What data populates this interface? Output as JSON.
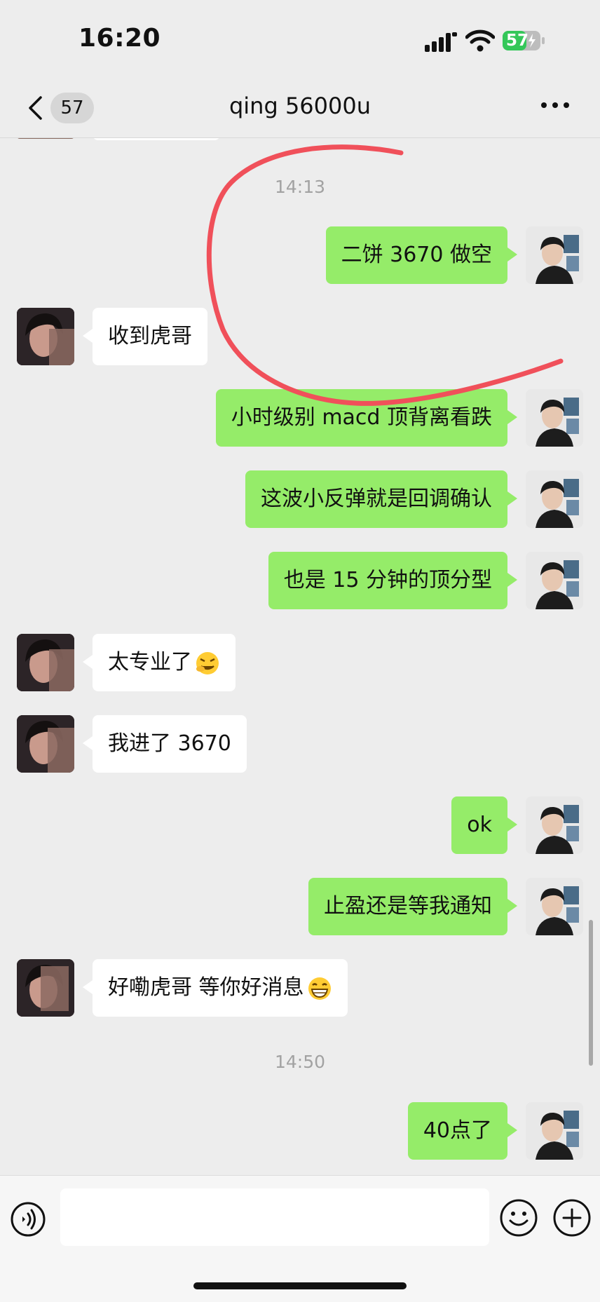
{
  "status_bar": {
    "time": "16:20",
    "battery": "57"
  },
  "header": {
    "unread_count": "57",
    "title": "qing 56000u"
  },
  "messages": {
    "ts1": "14:13",
    "m1": "二饼 3670 做空",
    "m2": "收到虎哥",
    "m3": "小时级别 macd 顶背离看跌",
    "m4": "这波小反弹就是回调确认",
    "m5": "也是 15 分钟的顶分型",
    "m6": "太专业了",
    "m7": "我进了  3670",
    "m8": "ok",
    "m9": "止盈还是等我通知",
    "m10": "好嘞虎哥  等你好消息",
    "ts2": "14:50",
    "m11": "40点了"
  },
  "colors": {
    "sent_bubble": "#95ec69",
    "received_bubble": "#ffffff",
    "annotation": "#f0505a"
  }
}
